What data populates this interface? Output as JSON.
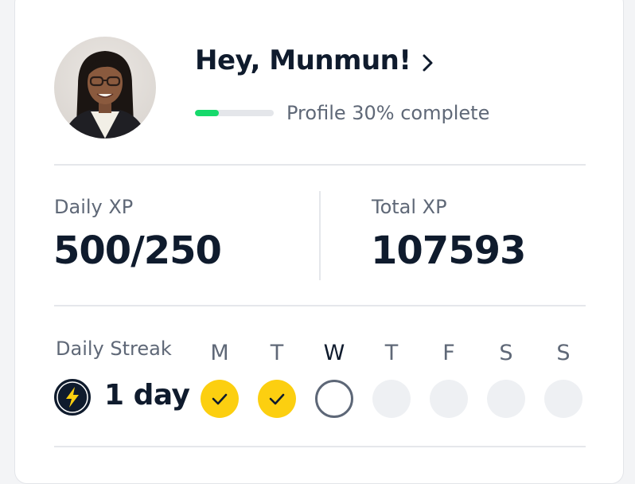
{
  "header": {
    "greeting": "Hey, Munmun!",
    "profile_progress_label": "Profile 30% complete",
    "profile_progress": 0.3
  },
  "xp": {
    "daily_label": "Daily XP",
    "daily_value": "500/250",
    "total_label": "Total XP",
    "total_value": "107593"
  },
  "streak": {
    "label": "Daily Streak",
    "value": "1 day",
    "days": [
      {
        "letter": "M",
        "state": "done"
      },
      {
        "letter": "T",
        "state": "done"
      },
      {
        "letter": "W",
        "state": "today"
      },
      {
        "letter": "T",
        "state": "future"
      },
      {
        "letter": "F",
        "state": "future"
      },
      {
        "letter": "S",
        "state": "future"
      },
      {
        "letter": "S",
        "state": "future"
      }
    ]
  },
  "icons": {
    "chevron": "chevron-right-icon",
    "streak": "lightning-bolt-icon",
    "check": "check-icon"
  },
  "colors": {
    "text_primary": "#0f1b2d",
    "text_secondary": "#5f6877",
    "progress_fill": "#16d96b",
    "streak_done": "#fccf10",
    "bolt": "#fccf10"
  }
}
